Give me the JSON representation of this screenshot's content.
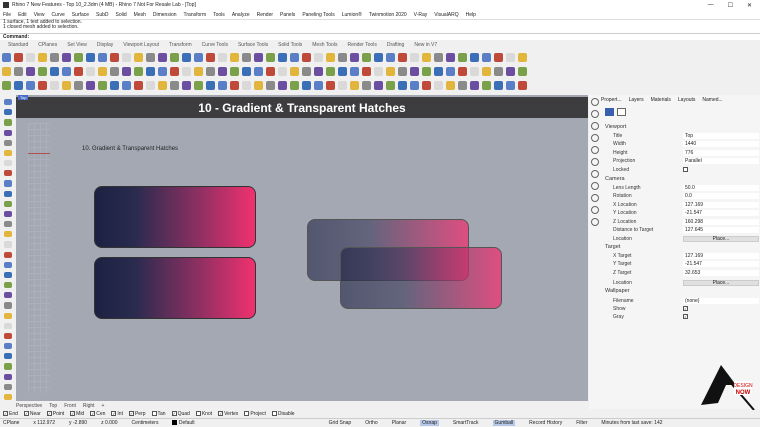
{
  "window": {
    "title": "Rhino 7 New Features - Top 10_2.3dm (4 MB) - Rhino 7 Not For Resale Lab - [Top]",
    "controls": [
      "—",
      "☐",
      "✕"
    ]
  },
  "menu": [
    "File",
    "Edit",
    "View",
    "Curve",
    "Surface",
    "SubD",
    "Solid",
    "Mesh",
    "Dimension",
    "Transform",
    "Tools",
    "Analyze",
    "Render",
    "Panels",
    "Paneling Tools",
    "Lumion®",
    "Twinmotion 2020",
    "V-Ray",
    "VisualARQ",
    "Help"
  ],
  "history": [
    "1 surface, 1 text added to selection.",
    "1 closed mesh added to selection."
  ],
  "command": "Command:",
  "toolbar_tabs": [
    "Standard",
    "CPlanes",
    "Set View",
    "Display",
    "Viewport Layout",
    "Transform",
    "Curve Tools",
    "Surface Tools",
    "Solid Tools",
    "Mesh Tools",
    "Render Tools",
    "Drafting",
    "New in V7"
  ],
  "viewport": {
    "label": "Top",
    "header": "10 - Gradient & Transparent Hatches",
    "subtitle": "10. Gradient & Transparent Hatches",
    "colors": {
      "dark": "#1c2141",
      "pink": "#f0316f"
    }
  },
  "panel": {
    "tabs": [
      "Propert...",
      "Layers",
      "Materials",
      "Layouts",
      "Named..."
    ],
    "viewport_section": "Viewport",
    "viewport_rows": [
      {
        "label": "Title",
        "value": "Top"
      },
      {
        "label": "Width",
        "value": "1440"
      },
      {
        "label": "Height",
        "value": "776"
      },
      {
        "label": "Projection",
        "value": "Parallel"
      },
      {
        "label": "Locked",
        "value": ""
      }
    ],
    "camera_section": "Camera",
    "camera_rows": [
      {
        "label": "Lens Length",
        "value": "50.0"
      },
      {
        "label": "Rotation",
        "value": "0.0"
      },
      {
        "label": "X Location",
        "value": "127.169"
      },
      {
        "label": "Y Location",
        "value": "-21.547"
      },
      {
        "label": "Z Location",
        "value": "160.298"
      },
      {
        "label": "Distance to Target",
        "value": "127.645"
      }
    ],
    "location_label": "Location",
    "place_button": "Place...",
    "target_section": "Target",
    "target_rows": [
      {
        "label": "X Target",
        "value": "127.169"
      },
      {
        "label": "Y Target",
        "value": "-21.547"
      },
      {
        "label": "Z Target",
        "value": "32.653"
      }
    ],
    "wallpaper_section": "Wallpaper",
    "filename_label": "Filename",
    "filename_value": "(none)",
    "show_label": "Show",
    "gray_label": "Gray"
  },
  "viewport_tabs": [
    "Perspective",
    "Top",
    "Front",
    "Right",
    "+"
  ],
  "osnaps": [
    {
      "label": "End",
      "on": true
    },
    {
      "label": "Near",
      "on": true
    },
    {
      "label": "Point",
      "on": true
    },
    {
      "label": "Mid",
      "on": true
    },
    {
      "label": "Cen",
      "on": true
    },
    {
      "label": "Int",
      "on": true
    },
    {
      "label": "Perp",
      "on": true
    },
    {
      "label": "Tan",
      "on": false
    },
    {
      "label": "Quad",
      "on": true
    },
    {
      "label": "Knot",
      "on": false
    },
    {
      "label": "Vertex",
      "on": true
    },
    {
      "label": "Project",
      "on": false
    },
    {
      "label": "Disable",
      "on": false
    }
  ],
  "status": {
    "cplane": "CPlane",
    "x": "x 112.972",
    "y": "y -2.890",
    "z": "z 0.000",
    "units": "Centimeters",
    "layer": "Default",
    "grid_snap": "Grid Snap",
    "ortho": "Ortho",
    "planar": "Planar",
    "osnap": "Osnap",
    "smarttrack": "SmartTrack",
    "gumball": "Gumball",
    "record_history": "Record History",
    "filter": "Filter",
    "minutes": "Minutes from last save: 142"
  },
  "brand": "DESIGN NOW"
}
